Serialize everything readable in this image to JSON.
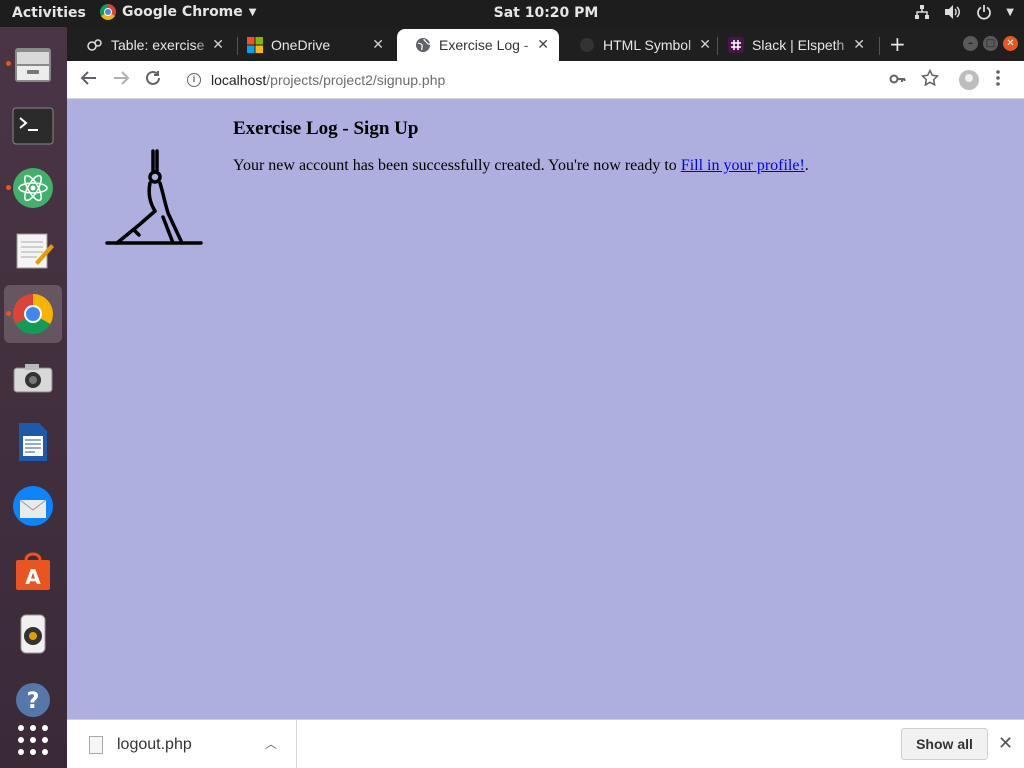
{
  "topbar": {
    "activities": "Activities",
    "app_name": "Google Chrome",
    "clock": "Sat 10:20 PM"
  },
  "dock": {
    "items": [
      {
        "name": "files-icon",
        "active": false,
        "running": true
      },
      {
        "name": "terminal-icon",
        "active": false,
        "running": false
      },
      {
        "name": "atom-icon",
        "active": false,
        "running": true
      },
      {
        "name": "text-editor-icon",
        "active": false,
        "running": false
      },
      {
        "name": "chrome-icon",
        "active": true,
        "running": true
      },
      {
        "name": "camera-icon",
        "active": false,
        "running": false
      },
      {
        "name": "writer-icon",
        "active": false,
        "running": false
      },
      {
        "name": "thunderbird-icon",
        "active": false,
        "running": false
      },
      {
        "name": "software-center-icon",
        "active": false,
        "running": false
      },
      {
        "name": "speaker-icon",
        "active": false,
        "running": false
      },
      {
        "name": "help-icon",
        "active": false,
        "running": false
      },
      {
        "name": "app-grid-icon",
        "active": false,
        "running": false
      }
    ]
  },
  "tabs": [
    {
      "title": "Table: exercise",
      "icon": "phpmyadmin-icon",
      "active": false
    },
    {
      "title": "OneDrive",
      "icon": "microsoft-icon",
      "active": false
    },
    {
      "title": "Exercise Log - ",
      "icon": "globe-icon",
      "active": true
    },
    {
      "title": "HTML Symbol",
      "icon": "dark-site-icon",
      "active": false
    },
    {
      "title": "Slack | Elspeth",
      "icon": "slack-icon",
      "active": false
    }
  ],
  "address": {
    "host": "localhost",
    "path": "/projects/project2/signup.php"
  },
  "page": {
    "heading": "Exercise Log - Sign Up",
    "message_before": "Your new account has been successfully created. You're now ready to ",
    "link_text": "Fill in your profile!",
    "message_after": ".",
    "background": "#afafdf"
  },
  "download_shelf": {
    "filename": "logout.php",
    "show_all": "Show all"
  }
}
